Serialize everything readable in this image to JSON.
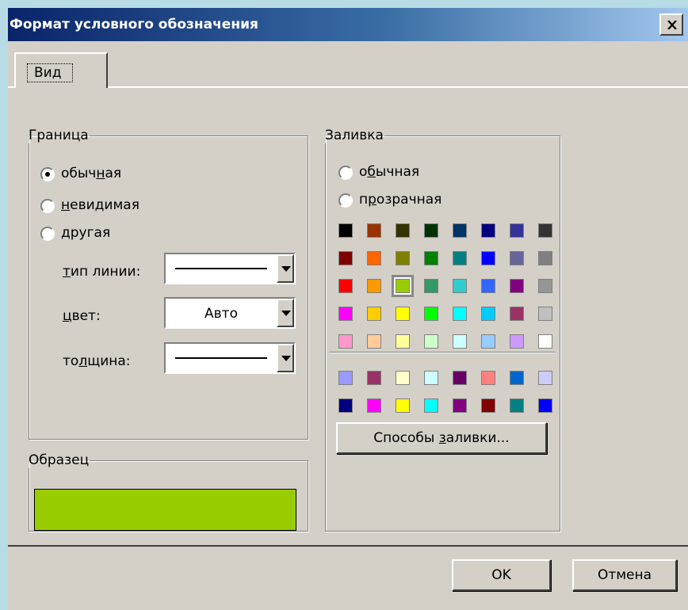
{
  "window": {
    "title": "Формат условного обозначения",
    "close_label": "×"
  },
  "tabs": [
    {
      "label": "Вид",
      "active": true
    }
  ],
  "border_group": {
    "legend": "Граница",
    "options": [
      {
        "label": "обычная",
        "checked": true
      },
      {
        "label": "невидимая",
        "checked": false
      },
      {
        "label": "другая",
        "checked": false
      }
    ],
    "line_type_label": "тип линии:",
    "color_label": "цвет:",
    "color_value": "Авто",
    "thickness_label": "толщина:"
  },
  "fill_group": {
    "legend": "Заливка",
    "options": [
      {
        "label": "обычная",
        "checked": false
      },
      {
        "label": "прозрачная",
        "checked": false
      }
    ],
    "palette_main": [
      [
        "#000000",
        "#993300",
        "#333300",
        "#003300",
        "#003366",
        "#000080",
        "#333399",
        "#333333"
      ],
      [
        "#800000",
        "#ff6600",
        "#808000",
        "#008000",
        "#008080",
        "#0000ff",
        "#666699",
        "#808080"
      ],
      [
        "#ff0000",
        "#ff9900",
        "#99cc00",
        "#339966",
        "#33cccc",
        "#3366ff",
        "#800080",
        "#969696"
      ],
      [
        "#ff00ff",
        "#ffcc00",
        "#ffff00",
        "#00ff00",
        "#00ffff",
        "#00ccff",
        "#993366",
        "#c0c0c0"
      ],
      [
        "#ff99cc",
        "#ffcc99",
        "#ffff99",
        "#ccffcc",
        "#ccffff",
        "#99ccff",
        "#cc99ff",
        "#ffffff"
      ]
    ],
    "palette_extra": [
      [
        "#9999ff",
        "#993366",
        "#ffffcc",
        "#ccffff",
        "#660066",
        "#ff8080",
        "#0066cc",
        "#ccccff"
      ],
      [
        "#000080",
        "#ff00ff",
        "#ffff00",
        "#00ffff",
        "#800080",
        "#800000",
        "#008080",
        "#0000ff"
      ]
    ],
    "selected_color": "#99cc00",
    "fill_effects_label": "Способы заливки..."
  },
  "sample_group": {
    "legend": "Образец",
    "color": "#99cc00"
  },
  "buttons": {
    "ok_label": "OK",
    "cancel_label": "Отмена"
  }
}
